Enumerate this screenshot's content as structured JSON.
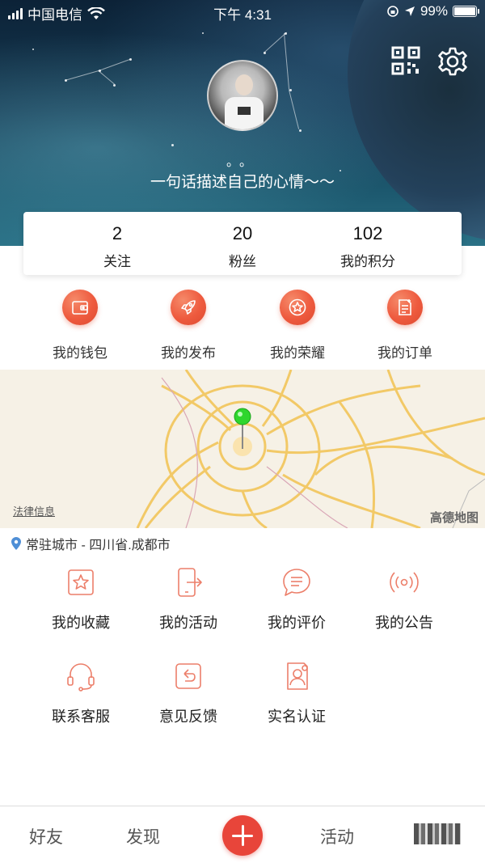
{
  "status_bar": {
    "carrier": "中国电信",
    "time": "下午 4:31",
    "battery": "99%",
    "battery_level": 0.99
  },
  "profile": {
    "nickname": "。。",
    "mood": "一句话描述自己的心情～～"
  },
  "stats": [
    {
      "value": "2",
      "label": "关注"
    },
    {
      "value": "20",
      "label": "粉丝"
    },
    {
      "value": "102",
      "label": "我的积分"
    }
  ],
  "quick_actions": [
    {
      "label": "我的钱包",
      "icon": "wallet-icon"
    },
    {
      "label": "我的发布",
      "icon": "rocket-icon"
    },
    {
      "label": "我的荣耀",
      "icon": "star-badge-icon"
    },
    {
      "label": "我的订单",
      "icon": "order-list-icon"
    }
  ],
  "map": {
    "legal": "法律信息",
    "brand": "高德地图"
  },
  "city": "常驻城市 - 四川省.成都市",
  "services": [
    {
      "label": "我的收藏",
      "icon": "favorite-star-icon"
    },
    {
      "label": "我的活动",
      "icon": "activity-export-icon"
    },
    {
      "label": "我的评价",
      "icon": "comment-icon"
    },
    {
      "label": "我的公告",
      "icon": "broadcast-icon"
    },
    {
      "label": "联系客服",
      "icon": "headset-icon"
    },
    {
      "label": "意见反馈",
      "icon": "feedback-icon"
    },
    {
      "label": "实名认证",
      "icon": "id-verify-icon"
    }
  ],
  "tabbar": {
    "friends": "好友",
    "discover": "发现",
    "activity": "活动"
  },
  "colors": {
    "accent": "#e8453a",
    "icon_line": "#ec7f6a"
  }
}
